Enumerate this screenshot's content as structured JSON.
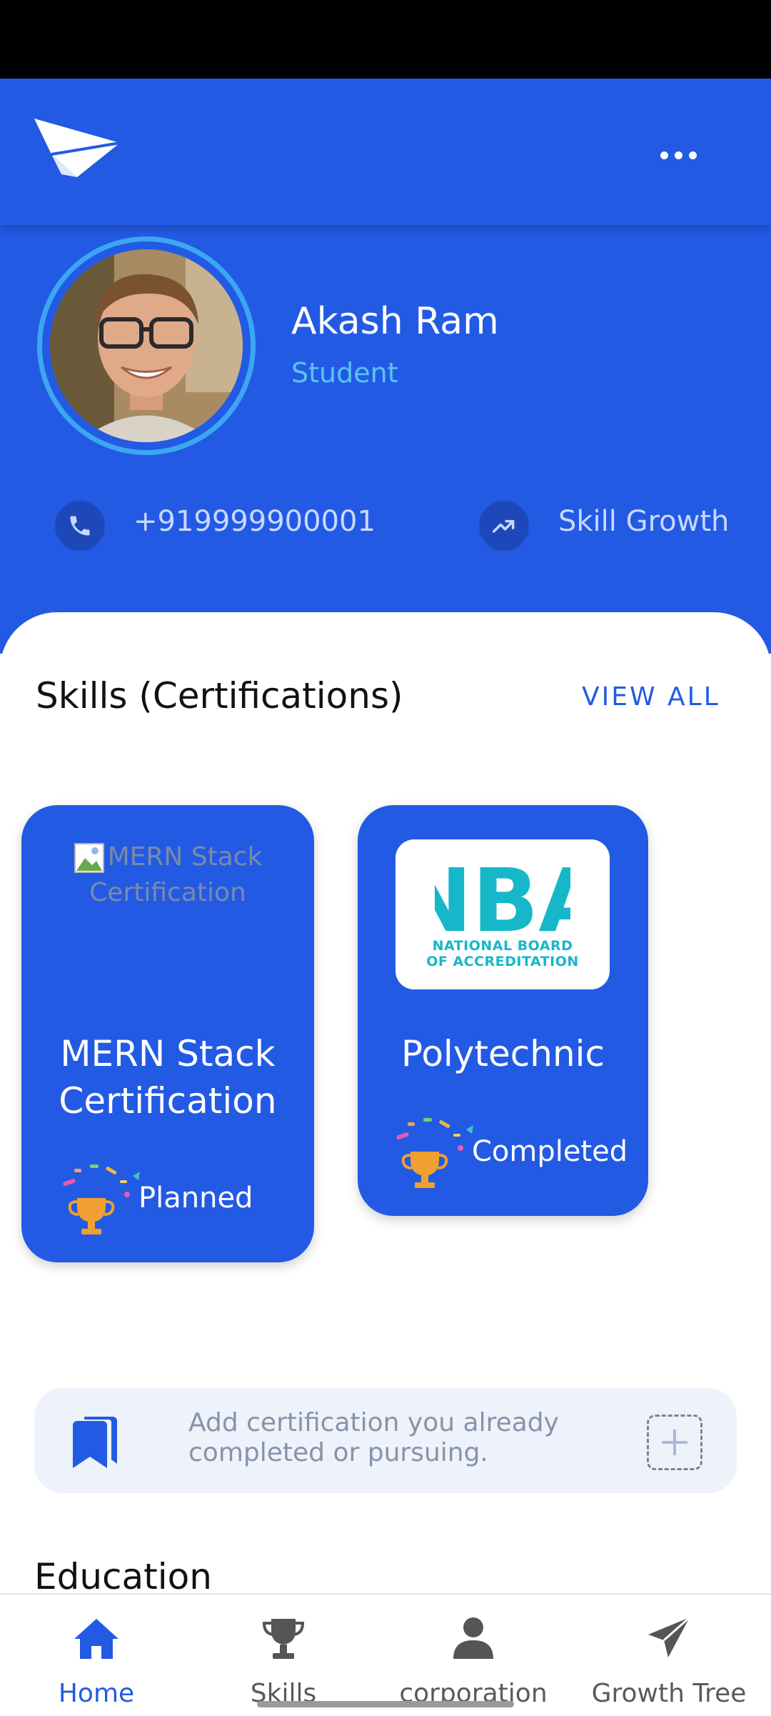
{
  "profile": {
    "name": "Akash Ram",
    "role": "Student",
    "phone": "+919999900001",
    "growth_label": "Skill Growth"
  },
  "skills_section": {
    "title": "Skills (Certifications)",
    "view_all": "VIEW ALL",
    "cards": [
      {
        "image_alt": "MERN Stack Certification",
        "title_line1": "MERN Stack",
        "title_line2": "Certification",
        "status": "Planned"
      },
      {
        "logo_text": "NBA",
        "logo_line1": "NATIONAL BOARD",
        "logo_line2": "OF ACCREDITATION",
        "title": "Polytechnic",
        "status": "Completed"
      }
    ]
  },
  "add_certification": {
    "text": "Add certification you already completed or pursuing."
  },
  "education_section": {
    "title": "Education"
  },
  "bottom_nav": {
    "items": [
      {
        "label": "Home",
        "icon": "home-icon",
        "active": true
      },
      {
        "label": "Skills",
        "icon": "trophy-icon",
        "active": false
      },
      {
        "label": "corporation",
        "icon": "person-icon",
        "active": false
      },
      {
        "label": "Growth Tree",
        "icon": "send-icon",
        "active": false
      }
    ]
  },
  "colors": {
    "primary": "#235ae4",
    "accent_light_blue": "#59c3f5",
    "avatar_ring": "#3ba7f2",
    "add_box_bg": "#eef2fb"
  }
}
